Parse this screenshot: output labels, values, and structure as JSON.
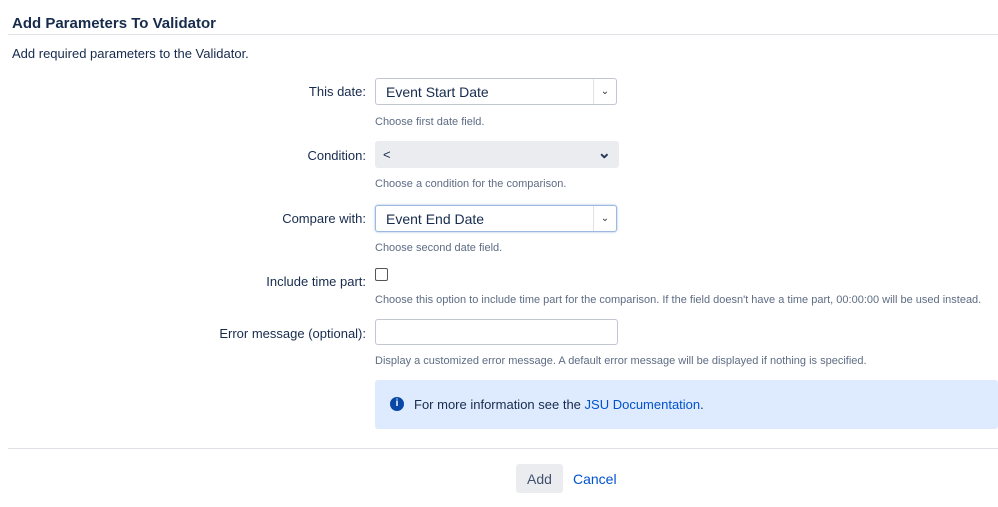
{
  "title": "Add Parameters To Validator",
  "description": "Add required parameters to the Validator.",
  "fields": {
    "this_date": {
      "label": "This date:",
      "value": "Event Start Date",
      "help": "Choose first date field."
    },
    "condition": {
      "label": "Condition:",
      "value": "<",
      "help": "Choose a condition for the comparison."
    },
    "compare_with": {
      "label": "Compare with:",
      "value": "Event End Date",
      "help": "Choose second date field."
    },
    "include_time": {
      "label": "Include time part:",
      "checked": false,
      "help": "Choose this option to include time part for the comparison. If the field doesn't have a time part, 00:00:00 will be used instead."
    },
    "error_message": {
      "label": "Error message (optional):",
      "value": "",
      "help": "Display a customized error message. A default error message will be displayed if nothing is specified."
    }
  },
  "info": {
    "icon": "info-icon",
    "text": "For more information see the ",
    "link": "JSU Documentation",
    "suffix": "."
  },
  "buttons": {
    "add": "Add",
    "cancel": "Cancel"
  }
}
